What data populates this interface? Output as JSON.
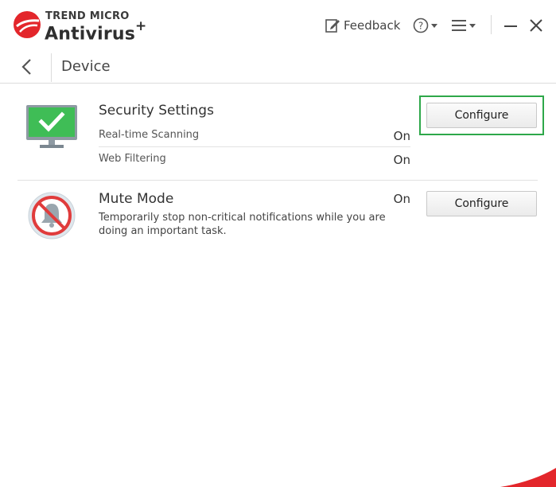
{
  "app": {
    "brand_top": "TREND MICRO",
    "brand_name": "Antivirus",
    "brand_suffix": "+",
    "accent_color": "#e3262b"
  },
  "header": {
    "feedback_label": "Feedback",
    "help_icon": "question-circle-icon",
    "menu_icon": "hamburger-menu-icon"
  },
  "nav": {
    "title": "Device"
  },
  "security": {
    "title": "Security Settings",
    "rows": [
      {
        "label": "Real-time Scanning",
        "value": "On"
      },
      {
        "label": "Web Filtering",
        "value": "On"
      }
    ],
    "configure_label": "Configure",
    "focus_color": "#2ea84a"
  },
  "mute": {
    "title": "Mute Mode",
    "status": "On",
    "description": "Temporarily stop non-critical notifications while you are doing an important task.",
    "configure_label": "Configure"
  }
}
